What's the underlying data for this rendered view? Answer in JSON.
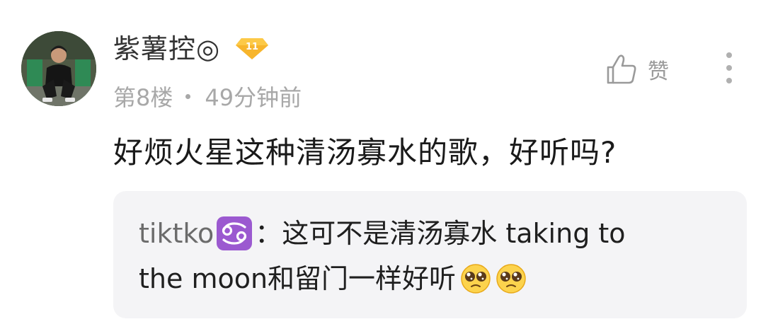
{
  "comment": {
    "username": "紫薯控◎",
    "level": "11",
    "floor": "第8楼",
    "time_ago": "49分钟前",
    "like_label": "赞",
    "text": "好烦火星这种清汤寡水的歌，好听吗?"
  },
  "reply": {
    "username": "tiktko",
    "separator": "：",
    "line1_text": "这可不是清汤寡水 taking to",
    "line2_text": "the moon和留门一样好听",
    "zodiac_icon": "cancer-zodiac-icon",
    "emojis": [
      "pleading-face-emoji",
      "pleading-face-emoji"
    ]
  },
  "colors": {
    "username": "#333333",
    "meta": "#a8a8a8",
    "reply_bg": "#f4f4f6",
    "zodiac_bg": "#9b59d0",
    "level_badge": "#f7b52c"
  }
}
